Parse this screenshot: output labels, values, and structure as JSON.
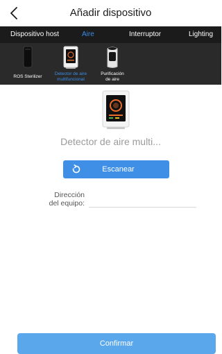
{
  "header": {
    "title": "Añadir dispositivo",
    "back_icon": "chevron-left-icon"
  },
  "tabs": [
    {
      "label": "Dispositivo host",
      "active": false
    },
    {
      "label": "Aire",
      "active": true
    },
    {
      "label": "Interruptor",
      "active": false
    },
    {
      "label": "Lighting",
      "active": false
    }
  ],
  "device_types": [
    {
      "label_line1": "ROS Sterilizer",
      "label_line2": "",
      "icon": "sterilizer-icon",
      "active": false
    },
    {
      "label_line1": "Detector de aire",
      "label_line2": "multifuncional",
      "icon": "air-detector-icon",
      "active": true
    },
    {
      "label_line1": "Purificación",
      "label_line2": "de aire",
      "icon": "air-purifier-icon",
      "active": false
    }
  ],
  "selected_device": {
    "name": "Detector de aire multi...",
    "icon": "air-detector-icon"
  },
  "scan_button": {
    "label": "Escanear",
    "icon": "refresh-icon"
  },
  "address": {
    "label_line1": "Dirección",
    "label_line2": "del equipo:",
    "value": "",
    "placeholder": ""
  },
  "confirm_button": {
    "label": "Confirmar"
  },
  "colors": {
    "accent": "#3f8fe6",
    "active_tab": "#3a8ee6",
    "tab_bar": "#1b1b1b",
    "device_bar": "#2a2a2a",
    "confirm": "#5aa7ec"
  }
}
